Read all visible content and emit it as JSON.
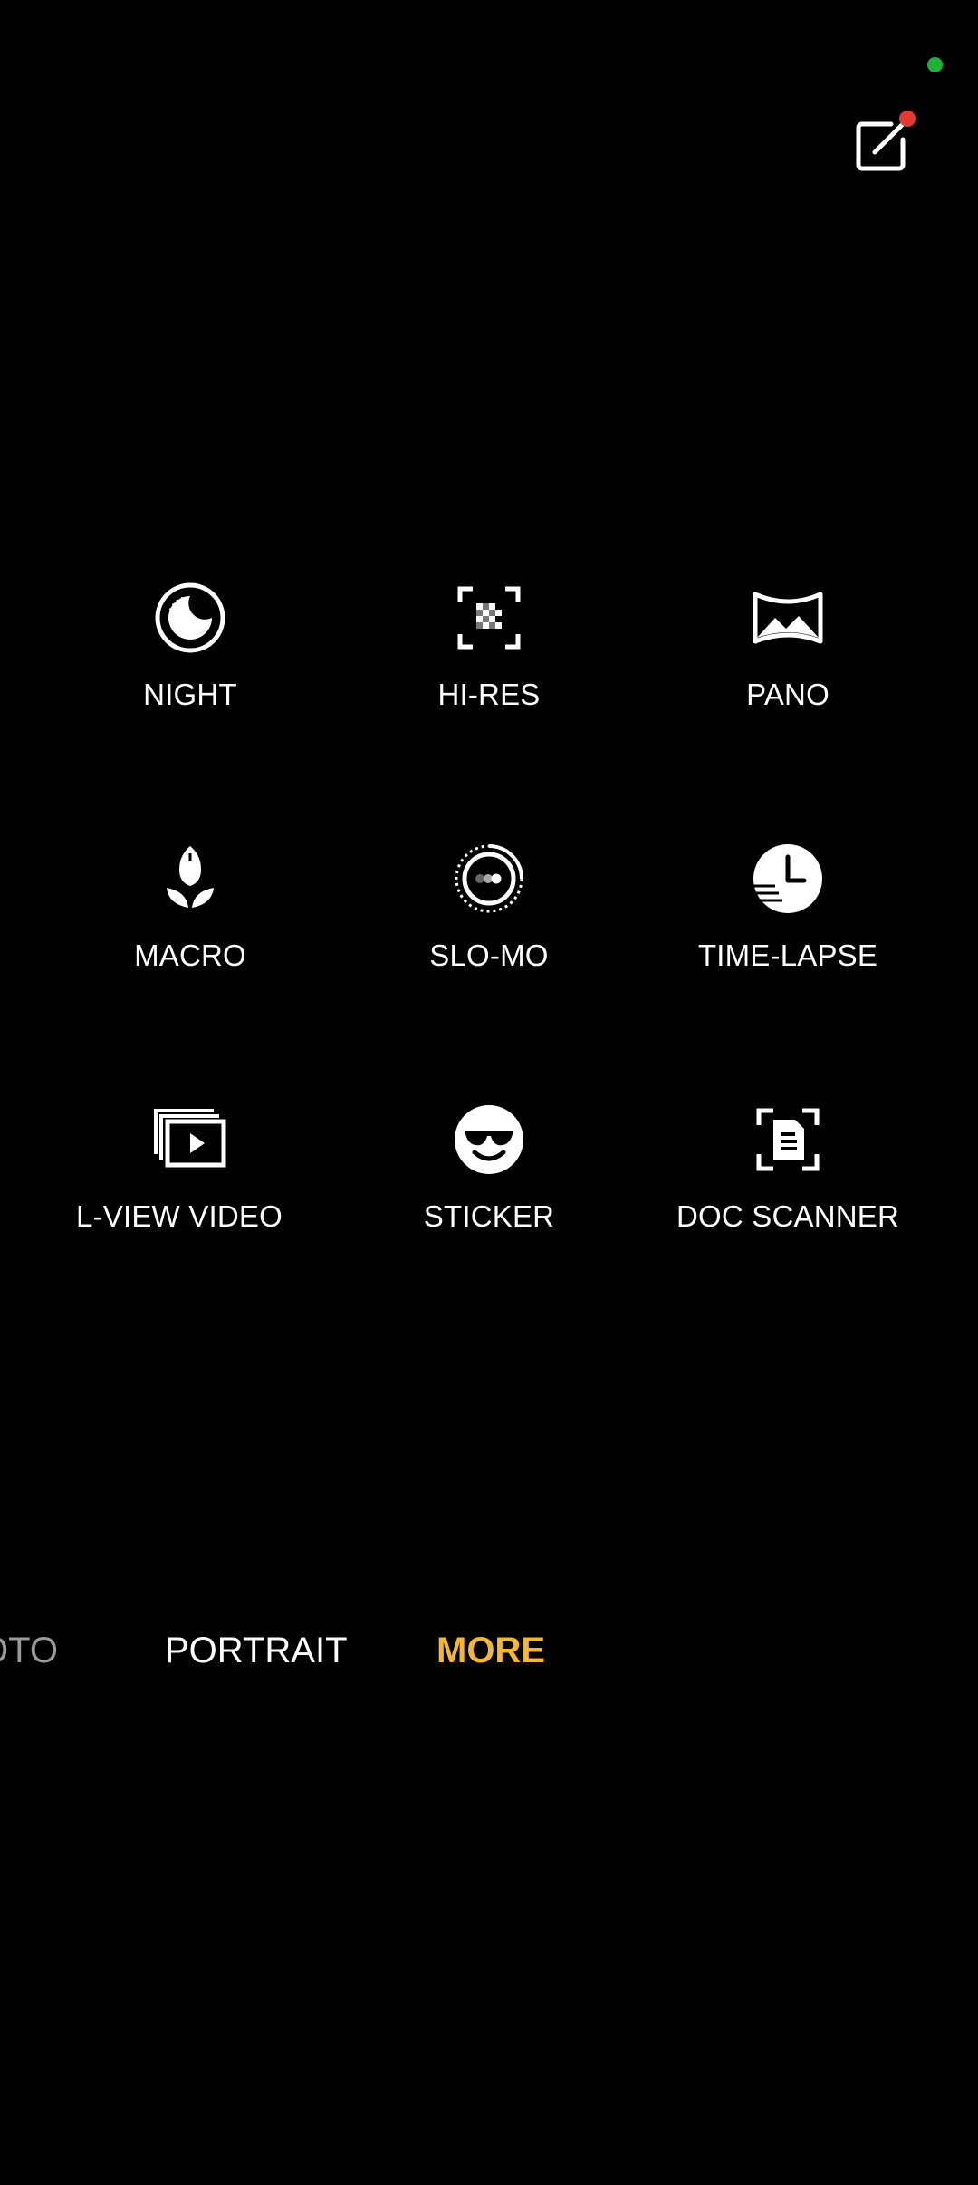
{
  "status": {
    "privacy_indicator_color": "#1db33a"
  },
  "top_bar": {
    "edit_icon": "edit-icon",
    "badge_color": "#e53935"
  },
  "modes": [
    {
      "label": "NIGHT",
      "icon": "night-icon"
    },
    {
      "label": "HI-RES",
      "icon": "hi-res-icon"
    },
    {
      "label": "PANO",
      "icon": "pano-icon"
    },
    {
      "label": "MACRO",
      "icon": "macro-icon"
    },
    {
      "label": "SLO-MO",
      "icon": "slo-mo-icon"
    },
    {
      "label": "TIME-LAPSE",
      "icon": "time-lapse-icon"
    },
    {
      "label": "L-VIEW VIDEO",
      "icon": "dual-view-video-icon"
    },
    {
      "label": "STICKER",
      "icon": "sticker-icon"
    },
    {
      "label": "DOC SCANNER",
      "icon": "doc-scanner-icon"
    }
  ],
  "mode_bar": {
    "tabs": [
      {
        "label": "OTO",
        "state": "partial"
      },
      {
        "label": "PORTRAIT",
        "state": "normal"
      },
      {
        "label": "MORE",
        "state": "selected"
      }
    ],
    "selected_color": "#f4b731"
  }
}
